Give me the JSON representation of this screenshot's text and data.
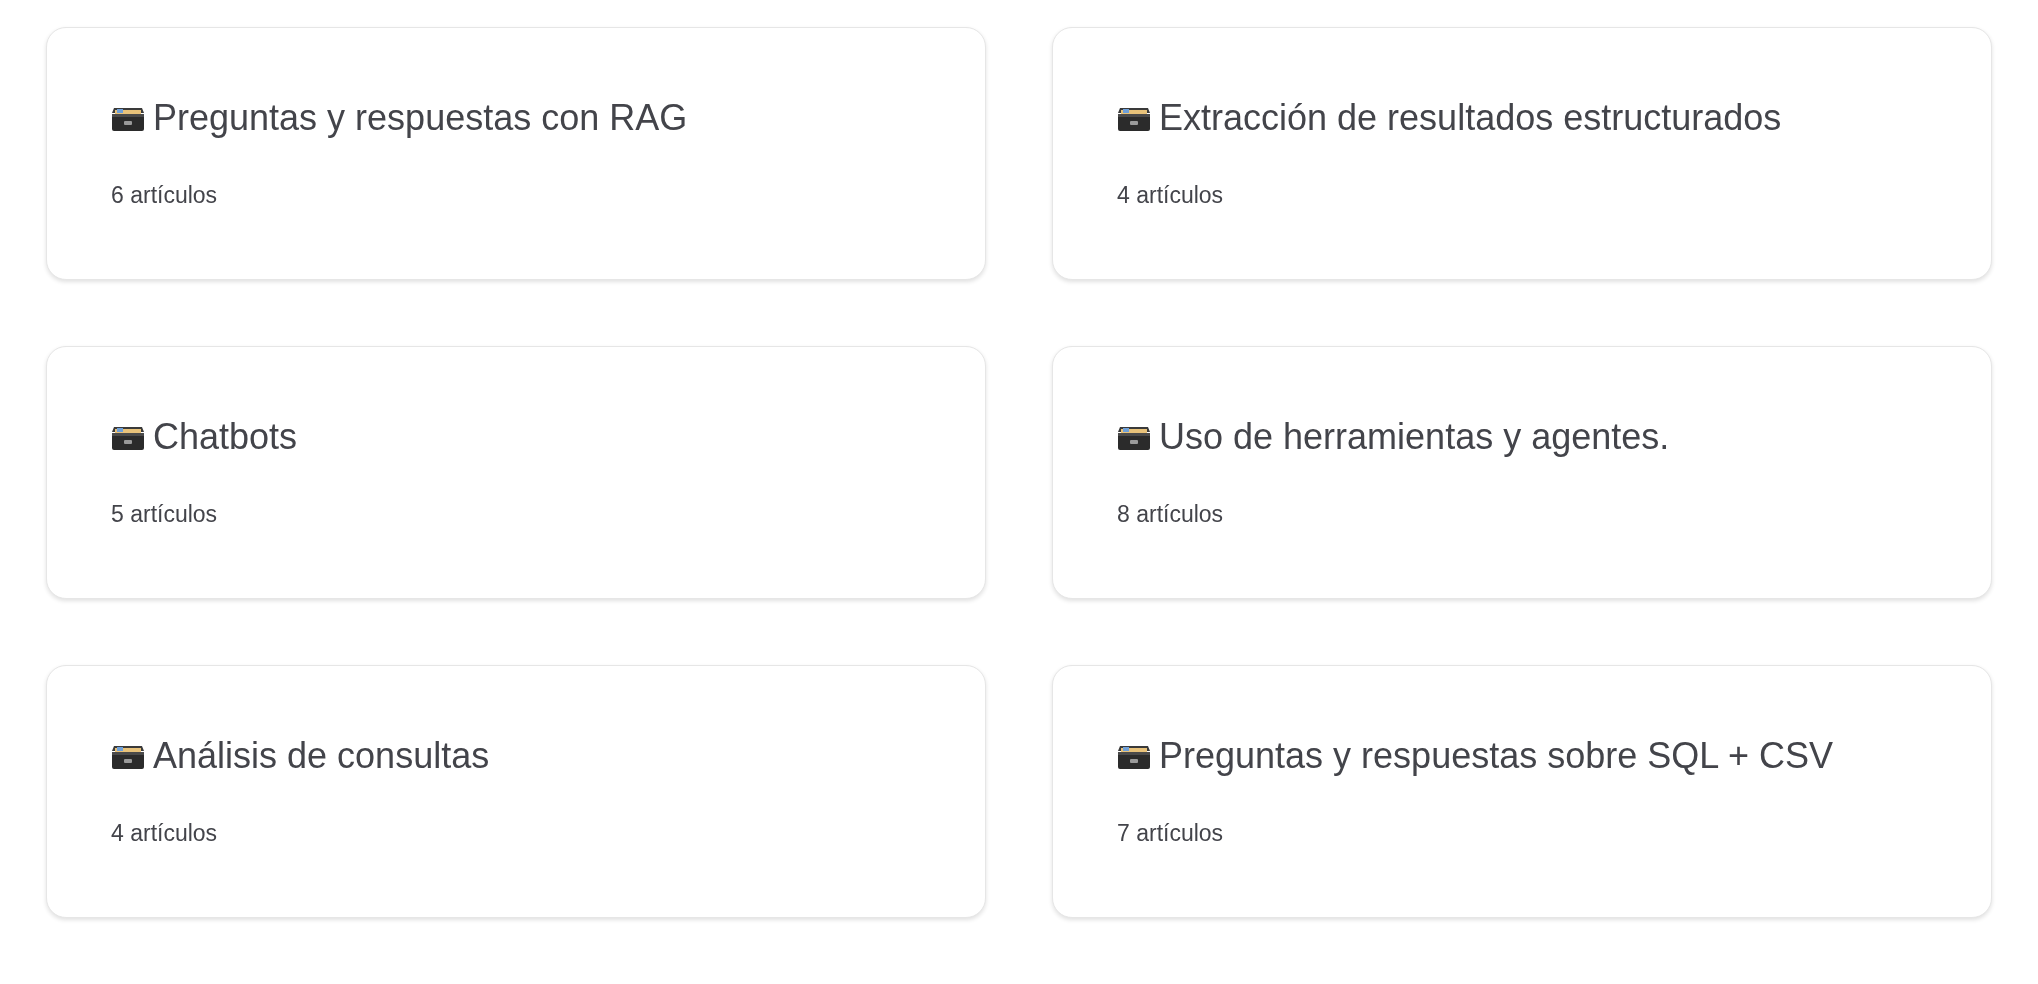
{
  "cards": [
    {
      "title": "Preguntas y respuestas con RAG",
      "count": "6 artículos"
    },
    {
      "title": "Extracción de resultados estructurados",
      "count": "4 artículos"
    },
    {
      "title": "Chatbots",
      "count": "5 artículos"
    },
    {
      "title": "Uso de herramientas y agentes.",
      "count": "8 artículos"
    },
    {
      "title": "Análisis de consultas",
      "count": "4 artículos"
    },
    {
      "title": "Preguntas y respuestas sobre SQL + CSV",
      "count": "7 artículos"
    }
  ]
}
